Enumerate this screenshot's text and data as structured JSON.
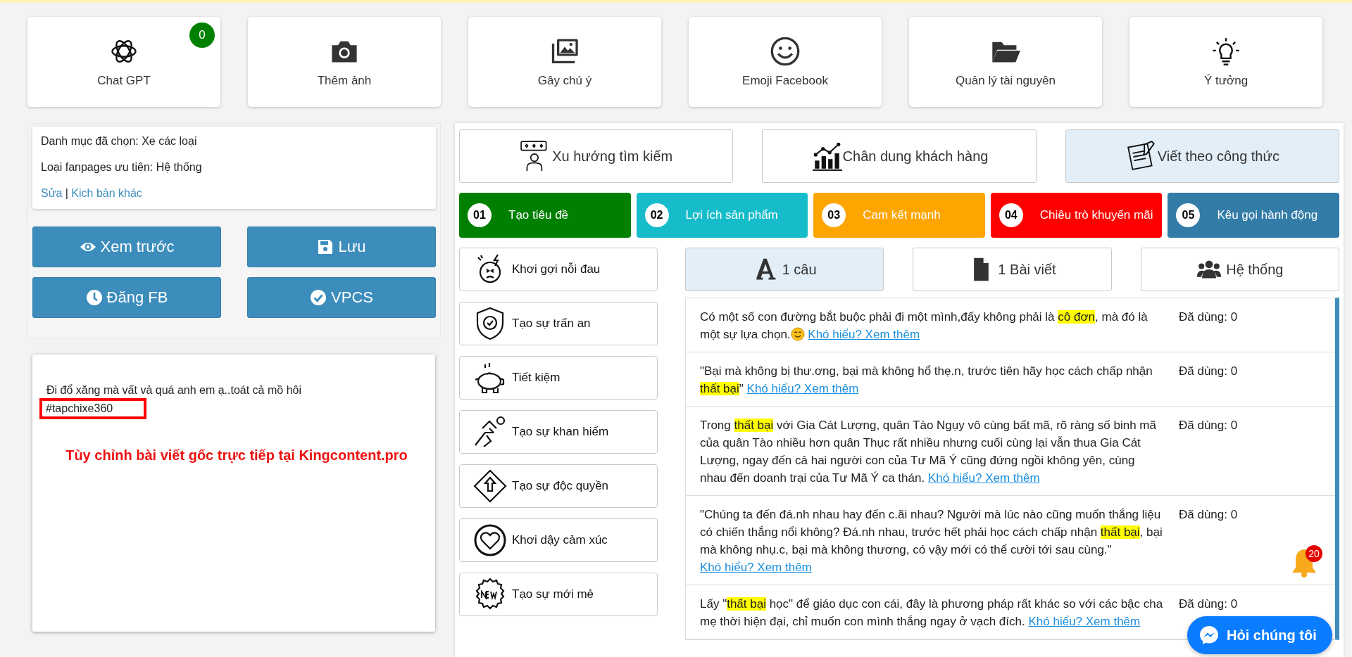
{
  "tools": [
    {
      "label": "Chat GPT",
      "badge": "0"
    },
    {
      "label": "Thêm ảnh"
    },
    {
      "label": "Gây chú ý"
    },
    {
      "label": "Emoji Facebook"
    },
    {
      "label": "Quản lý tài nguyên"
    },
    {
      "label": "Ý tưởng"
    }
  ],
  "info": {
    "category": "Danh mục đã chọn: Xe các loại",
    "fanpage": "Loại fanpages ưu tiên: Hệ thống",
    "edit_link": "Sửa",
    "separator": "|",
    "other_link": "Kịch bản khác"
  },
  "actions": [
    {
      "label": "Xem trước"
    },
    {
      "label": "Lưu"
    },
    {
      "label": "Đăng FB"
    },
    {
      "label": "VPCS"
    }
  ],
  "post": {
    "text": "Đi đổ xăng mà vất vả quá anh em ạ..toát cả mồ hôi",
    "hashtag": "#tapchixe360",
    "notice": "Tùy chỉnh bài viết gốc trực tiếp tại Kingcontent.pro"
  },
  "modes": [
    {
      "label": "Xu hướng tìm kiếm",
      "selected": false
    },
    {
      "label": "Chân dung khách hàng",
      "selected": false
    },
    {
      "label": "Viết theo công thức",
      "selected": true
    }
  ],
  "steps": [
    {
      "number": "01",
      "label": "Tạo tiêu đề",
      "color": "#008000"
    },
    {
      "number": "02",
      "label": "Lợi ích sản phẩm",
      "color": "#17bccb"
    },
    {
      "number": "03",
      "label": "Cam kết mạnh",
      "color": "#ffa500"
    },
    {
      "number": "04",
      "label": "Chiêu trò khuyến mãi",
      "color": "#ff0000"
    },
    {
      "number": "05",
      "label": "Kêu gọi hành động",
      "color": "#337ca8"
    }
  ],
  "triggers": [
    {
      "label": "Khơi gợi nỗi đau"
    },
    {
      "label": "Tạo sự trấn an"
    },
    {
      "label": "Tiết kiệm"
    },
    {
      "label": "Tạo sự khan hiếm"
    },
    {
      "label": "Tạo sự độc quyền"
    },
    {
      "label": "Khơi dậy cảm xúc"
    },
    {
      "label": "Tạo sự mới mẻ"
    }
  ],
  "lengths": [
    {
      "label": "1 câu",
      "selected": true
    },
    {
      "label": "1 Bài viết",
      "selected": false
    },
    {
      "label": "Hệ thống",
      "selected": false
    }
  ],
  "quotes": [
    {
      "segments": [
        {
          "text": "Có một số con đường bắt buộc phải đi một mình,đấy không phải là ",
          "highlight": false
        },
        {
          "text": "cô đơn",
          "highlight": true
        },
        {
          "text": ", mà đó là một sự lựa chọn.",
          "highlight": false
        }
      ],
      "emoji": true,
      "link": "Khó hiểu? Xem thêm",
      "used": "Đã dùng: 0"
    },
    {
      "segments": [
        {
          "text": "\"Bại mà không bị thư.ơng, bại mà không hổ thẹ.n, trước tiên hãy học cách chấp nhận ",
          "highlight": false
        },
        {
          "text": "thất bại",
          "highlight": true
        },
        {
          "text": "\"",
          "highlight": false
        }
      ],
      "emoji": false,
      "link": "Khó hiểu? Xem thêm",
      "used": "Đã dùng: 0"
    },
    {
      "segments": [
        {
          "text": "Trong ",
          "highlight": false
        },
        {
          "text": "thất bại",
          "highlight": true
        },
        {
          "text": " với Gia Cát Lượng, quân Tào Ngụy vô cùng bất mã, rõ ràng số binh mã của quân Tào nhiều hơn quân Thục rất nhiều nhưng cuối cùng lại vẫn thua Gia Cát Lượng, ngay đến cả hai người con của Tư Mã Ý cũng đứng ngồi không yên, cùng nhau đến doanh trại của Tư Mã Ý ca thán.",
          "highlight": false
        }
      ],
      "emoji": false,
      "link": "Khó hiểu? Xem thêm",
      "used": "Đã dùng: 0"
    },
    {
      "segments": [
        {
          "text": "\"Chúng ta đến đá.nh nhau hay đến c.ãi nhau? Người mà lúc nào cũng muốn thắng liệu có chiến thắng nổi không? Đá.nh nhau, trước hết phải học cách chấp nhận ",
          "highlight": false
        },
        {
          "text": "thất bại",
          "highlight": true
        },
        {
          "text": ", bại mà không nhụ.c, bại mà không thương, có vậy mới có thể cười tới sau cùng.\"",
          "highlight": false
        }
      ],
      "emoji": false,
      "link": "Khó hiểu? Xem thêm",
      "used": "Đã dùng: 0"
    },
    {
      "segments": [
        {
          "text": "Lấy \"",
          "highlight": false
        },
        {
          "text": "thất bại",
          "highlight": true
        },
        {
          "text": " học\" để giáo dục con cái, đây là phương pháp rất khác so với các bậc cha mẹ thời hiện đại, chỉ muốn con mình thắng ngay ở vạch đích.",
          "highlight": false
        }
      ],
      "emoji": false,
      "link": "Khó hiểu? Xem thêm",
      "used": "Đã dùng: 0"
    }
  ],
  "notifications": {
    "count": "20"
  },
  "chat": {
    "label": "Hỏi chúng tôi"
  }
}
